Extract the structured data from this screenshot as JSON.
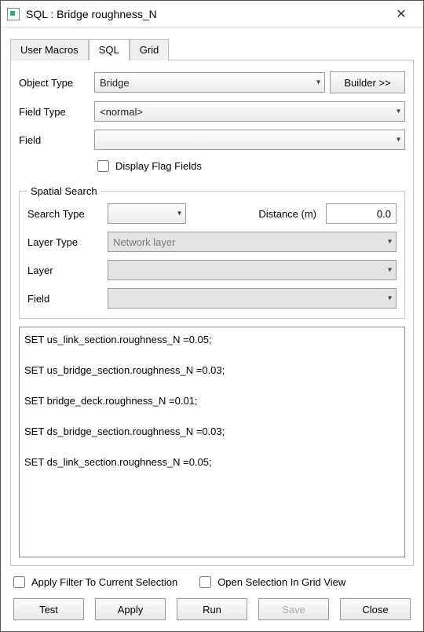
{
  "titlebar": {
    "title": "SQL : Bridge roughness_N"
  },
  "tabs": {
    "user_macros": "User Macros",
    "sql": "SQL",
    "grid": "Grid"
  },
  "form": {
    "object_type_label": "Object Type",
    "object_type_value": "Bridge",
    "builder_label": "Builder >>",
    "field_type_label": "Field Type",
    "field_type_value": "<normal>",
    "field_label": "Field",
    "field_value": "",
    "display_flag_label": "Display Flag Fields"
  },
  "spatial": {
    "legend": "Spatial Search",
    "search_type_label": "Search Type",
    "search_type_value": "",
    "distance_label": "Distance (m)",
    "distance_value": "0.0",
    "layer_type_label": "Layer Type",
    "layer_type_value": "Network layer",
    "layer_label": "Layer",
    "layer_value": "",
    "field_label": "Field",
    "field_value": ""
  },
  "sql_text": "SET us_link_section.roughness_N =0.05;\n\nSET us_bridge_section.roughness_N =0.03;\n\nSET bridge_deck.roughness_N =0.01;\n\nSET ds_bridge_section.roughness_N =0.03;\n\nSET ds_link_section.roughness_N =0.05;",
  "bottom": {
    "apply_filter_label": "Apply Filter To Current Selection",
    "open_selection_label": "Open Selection In Grid View"
  },
  "buttons": {
    "test": "Test",
    "apply": "Apply",
    "run": "Run",
    "save": "Save",
    "close": "Close"
  }
}
